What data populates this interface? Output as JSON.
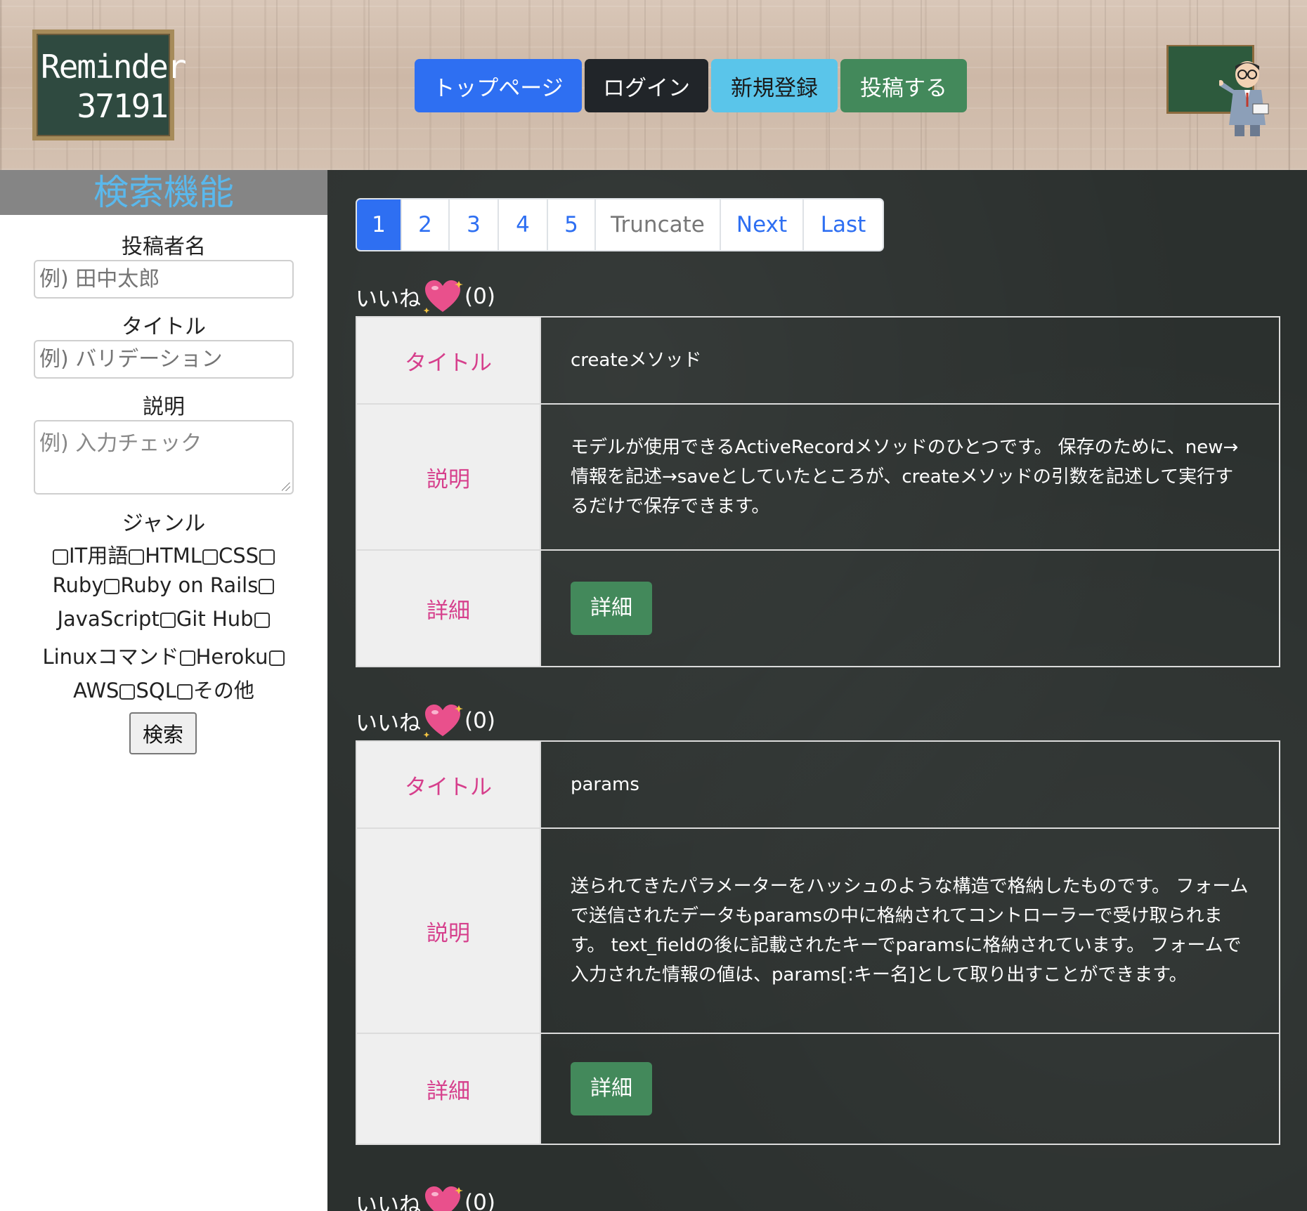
{
  "header": {
    "logo_line1": "Reminder",
    "logo_line2": "37191",
    "nav": {
      "top": "トップページ",
      "login": "ログイン",
      "register": "新規登録",
      "post": "投稿する"
    }
  },
  "sidebar": {
    "title": "検索機能",
    "author_label": "投稿者名",
    "author_placeholder": "例) 田中太郎",
    "title_label": "タイトル",
    "title_placeholder": "例) バリデーション",
    "description_label": "説明",
    "description_placeholder": "例) 入力チェック",
    "genre_label": "ジャンル",
    "genres": [
      "IT用語",
      "HTML",
      "CSS",
      "Ruby",
      "Ruby on Rails",
      "JavaScript",
      "Git Hub",
      "Linuxコマンド",
      "Heroku",
      "AWS",
      "SQL",
      "その他"
    ],
    "search_button": "検索"
  },
  "pagination": [
    "1",
    "2",
    "3",
    "4",
    "5",
    "Truncate",
    "Next",
    "Last"
  ],
  "posts": [
    {
      "likes_label": "いいね",
      "likes_count": "(0)",
      "title_head": "タイトル",
      "title": "createメソッド",
      "description_head": "説明",
      "description": "モデルが使用できるActiveRecordメソッドのひとつです。 保存のために、new→情報を記述→saveとしていたところが、createメソッドの引数を記述して実行するだけで保存できます。",
      "detail_head": "詳細",
      "detail_button": "詳細"
    },
    {
      "likes_label": "いいね",
      "likes_count": "(0)",
      "title_head": "タイトル",
      "title": "params",
      "description_head": "説明",
      "description": "送られてきたパラメーターをハッシュのような構造で格納したものです。 フォームで送信されたデータもparamsの中に格納されてコントローラーで受け取られます。 text_fieldの後に記載されたキーでparamsに格納されています。 フォームで入力された情報の値は、params[:キー名]として取り出すことができます。",
      "detail_head": "詳細",
      "detail_button": "詳細"
    },
    {
      "likes_label": "いいね",
      "likes_count": "(0)"
    }
  ],
  "colors": {
    "primary": "#2e6ff2",
    "dark": "#212529",
    "info": "#5ac5ea",
    "success": "#43895b",
    "label_pink": "#d63f8c",
    "sidebar_title": "#5ab8ec"
  }
}
